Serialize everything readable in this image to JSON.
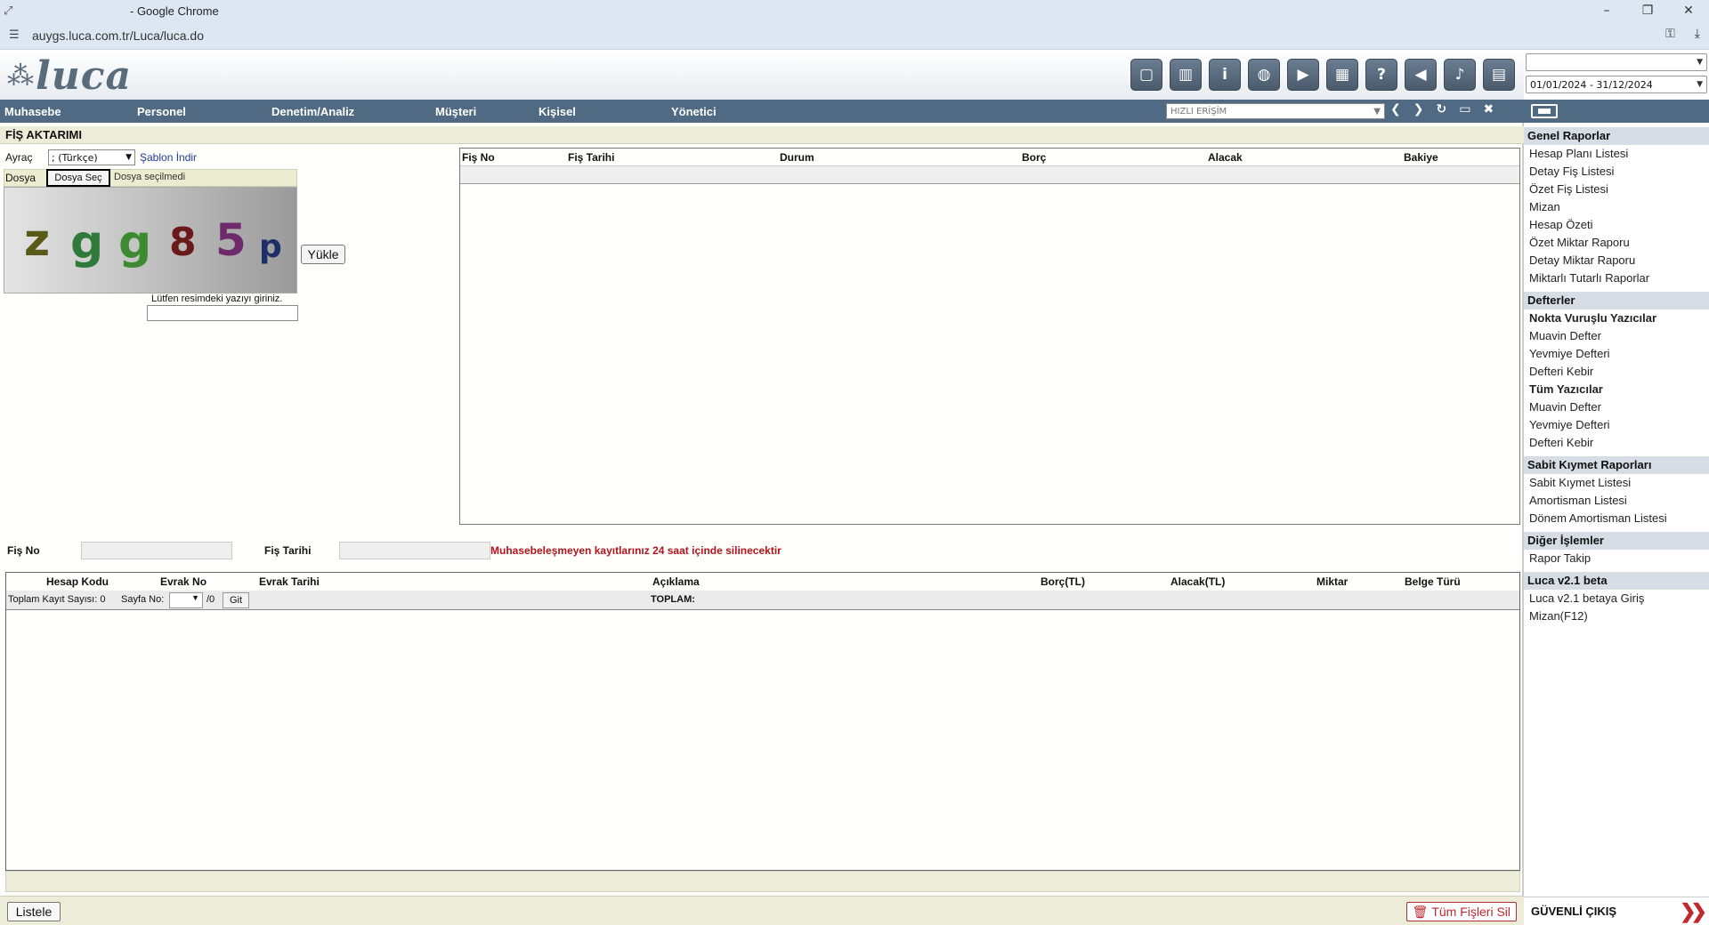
{
  "browser": {
    "title": "- Google Chrome",
    "url": "auygs.luca.com.tr/Luca/luca.do",
    "controls": [
      "–",
      "❐",
      "✕"
    ]
  },
  "logo": {
    "text": "luca"
  },
  "toolbar_icons": [
    "notes-icon",
    "book-icon",
    "info-icon",
    "globe-icon",
    "youtube-icon",
    "calculator-icon",
    "help-icon",
    "megaphone-icon",
    "bell-icon",
    "document-icon"
  ],
  "header": {
    "company_select": "",
    "period_select": "01/01/2024 - 31/12/2024"
  },
  "nav": {
    "items": [
      "Muhasebe",
      "Personel",
      "Denetim/Analiz",
      "Müşteri",
      "Kişisel",
      "Yönetici"
    ],
    "quick_access_placeholder": "HIZLI ERİŞİM"
  },
  "main": {
    "section_title": "FİŞ AKTARIMI",
    "ayrac_label": "Ayraç",
    "ayrac_value": "; (Türkçe)",
    "template_link": "Şablon İndir",
    "file_label": "Dosya",
    "file_button": "Dosya Seç",
    "file_status": "Dosya seçilmedi",
    "captcha_chars": [
      "z",
      "g",
      "g",
      "8",
      "5",
      "p"
    ],
    "upload_button": "Yükle",
    "captcha_hint": "Lütfen resimdeki yazıyı giriniz.",
    "captcha_input": ""
  },
  "voucher_table": {
    "columns": [
      "Fiş No",
      "Fiş Tarihi",
      "Durum",
      "Borç",
      "Alacak",
      "Bakiye"
    ]
  },
  "fis_row": {
    "fis_no_label": "Fiş No",
    "fis_tarihi_label": "Fiş Tarihi",
    "warning": "Muhasebeleşmeyen kayıtlarınız 24 saat içinde silinecektir"
  },
  "lines_table": {
    "columns": [
      "Hesap Kodu",
      "Evrak No",
      "Evrak Tarihi",
      "Açıklama",
      "Borç(TL)",
      "Alacak(TL)",
      "Miktar",
      "Belge Türü"
    ],
    "total_records_label": "Toplam Kayıt Sayısı: 0",
    "page_no_label": "Sayfa No:",
    "page_total": "/0",
    "go_button": "Git",
    "total_label": "TOPLAM:"
  },
  "bottom": {
    "list_button": "Listele",
    "delete_all_button": "Tüm Fişleri Sil"
  },
  "sidebar": {
    "general_reports": {
      "title": "Genel Raporlar",
      "items": [
        "Hesap Planı Listesi",
        "Detay Fiş Listesi",
        "Özet Fiş Listesi",
        "Mizan",
        "Hesap Özeti",
        "Özet Miktar Raporu",
        "Detay Miktar Raporu",
        "Miktarlı Tutarlı Raporlar"
      ]
    },
    "ledgers": {
      "title": "Defterler",
      "dot_printers": "Nokta Vuruşlu Yazıcılar",
      "dot_items": [
        "Muavin Defter",
        "Yevmiye Defteri",
        "Defteri Kebir"
      ],
      "all_printers": "Tüm Yazıcılar",
      "all_items": [
        "Muavin Defter",
        "Yevmiye Defteri",
        "Defteri Kebir"
      ]
    },
    "fixed_assets": {
      "title": "Sabit Kıymet Raporları",
      "items": [
        "Sabit Kıymet Listesi",
        "Amortisman Listesi",
        "Dönem Amortisman Listesi"
      ]
    },
    "other": {
      "title": "Diğer İşlemler",
      "items": [
        "Rapor Takip"
      ]
    },
    "beta": {
      "title": "Luca v2.1 beta",
      "items": [
        "Luca v2.1 betaya Giriş",
        "Mizan(F12)"
      ]
    },
    "logout": "GÜVENLİ ÇIKIŞ"
  }
}
